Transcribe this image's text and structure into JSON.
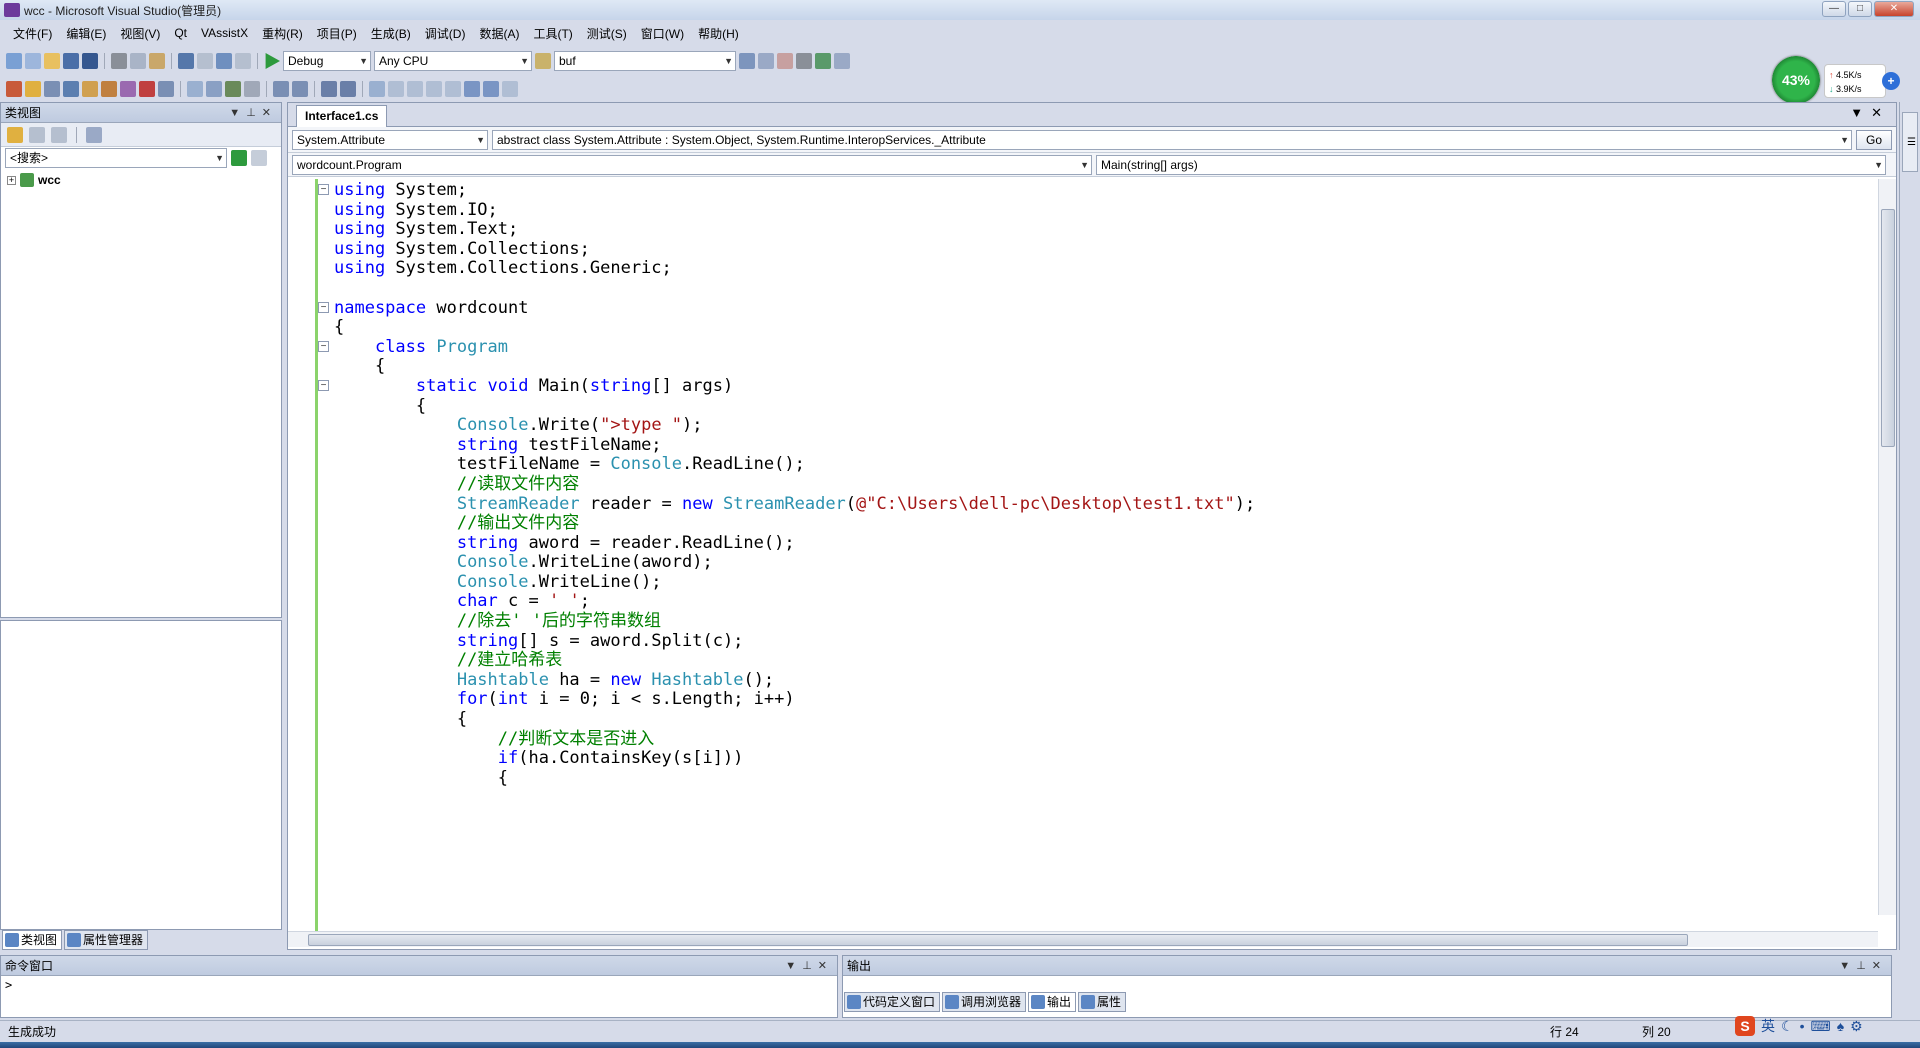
{
  "window": {
    "title": "wcc - Microsoft Visual Studio(管理员)"
  },
  "menu": [
    "文件(F)",
    "编辑(E)",
    "视图(V)",
    "Qt",
    "VAssistX",
    "重构(R)",
    "项目(P)",
    "生成(B)",
    "调试(D)",
    "数据(A)",
    "工具(T)",
    "测试(S)",
    "窗口(W)",
    "帮助(H)"
  ],
  "toolbar": {
    "config": "Debug",
    "platform": "Any CPU",
    "find": "buf"
  },
  "netwidget": {
    "percent": "43%",
    "up": "4.5K/s",
    "down": "3.9K/s",
    "plus": "+"
  },
  "classview": {
    "title": "类视图",
    "search_placeholder": "<搜索>",
    "tree_root": "wcc"
  },
  "left_tabs": [
    "类视图",
    "属性管理器"
  ],
  "editor": {
    "tab": "Interface1.cs",
    "nav_type": "System.Attribute",
    "nav_desc": "abstract class System.Attribute : System.Object, System.Runtime.InteropServices._Attribute",
    "go": "Go",
    "nav_class": "wordcount.Program",
    "nav_member": "Main(string[] args)"
  },
  "code_lines": [
    [
      [
        "kw",
        "using"
      ],
      [
        "",
        "System;"
      ]
    ],
    [
      [
        "kw",
        "using"
      ],
      [
        "",
        "System.IO;"
      ]
    ],
    [
      [
        "kw",
        "using"
      ],
      [
        "",
        "System.Text;"
      ]
    ],
    [
      [
        "kw",
        "using"
      ],
      [
        "",
        "System.Collections;"
      ]
    ],
    [
      [
        "kw",
        "using"
      ],
      [
        "",
        "System.Collections.Generic;"
      ]
    ],
    [],
    [
      [
        "kw",
        "namespace"
      ],
      [
        "",
        "wordcount"
      ]
    ],
    [
      [
        "",
        "{"
      ]
    ],
    [
      [
        "",
        "    "
      ],
      [
        "kw",
        "class"
      ],
      [
        "ty",
        "Program"
      ]
    ],
    [
      [
        "",
        "    {"
      ]
    ],
    [
      [
        "",
        "        "
      ],
      [
        "kw",
        "static"
      ],
      [
        "kw",
        "void"
      ],
      [
        "",
        "Main("
      ],
      [
        "kw",
        "string"
      ],
      [
        "",
        "[] args)"
      ]
    ],
    [
      [
        "",
        "        {"
      ]
    ],
    [
      [
        "",
        "            "
      ],
      [
        "ty",
        "Console"
      ],
      [
        "",
        ".Write("
      ],
      [
        "st",
        "\">type \""
      ],
      [
        "",
        ");"
      ]
    ],
    [
      [
        "",
        "            "
      ],
      [
        "kw",
        "string"
      ],
      [
        "",
        "testFileName;"
      ]
    ],
    [
      [
        "",
        "            testFileName = "
      ],
      [
        "ty",
        "Console"
      ],
      [
        "",
        ".ReadLine();"
      ]
    ],
    [
      [
        "",
        "            "
      ],
      [
        "cm",
        "//读取文件内容"
      ]
    ],
    [
      [
        "",
        "            "
      ],
      [
        "ty",
        "StreamReader"
      ],
      [
        "",
        "reader = "
      ],
      [
        "kw",
        "new"
      ],
      [
        "ty",
        "StreamReader"
      ],
      [
        "",
        "("
      ],
      [
        "st",
        "@\"C:\\Users\\dell-pc\\Desktop\\test1.txt\""
      ],
      [
        "",
        ");"
      ]
    ],
    [
      [
        "",
        "            "
      ],
      [
        "cm",
        "//输出文件内容"
      ]
    ],
    [
      [
        "",
        "            "
      ],
      [
        "kw",
        "string"
      ],
      [
        "",
        "aword = reader.ReadLine();"
      ]
    ],
    [
      [
        "",
        "            "
      ],
      [
        "ty",
        "Console"
      ],
      [
        "",
        ".WriteLine(aword);"
      ]
    ],
    [
      [
        "",
        "            "
      ],
      [
        "ty",
        "Console"
      ],
      [
        "",
        ".WriteLine();"
      ]
    ],
    [
      [
        "",
        "            "
      ],
      [
        "kw",
        "char"
      ],
      [
        "",
        "c = "
      ],
      [
        "st",
        "' '"
      ],
      [
        "",
        ";"
      ]
    ],
    [
      [
        "",
        "            "
      ],
      [
        "cm",
        "//除去' '后的字符串数组"
      ]
    ],
    [
      [
        "",
        "            "
      ],
      [
        "kw",
        "string"
      ],
      [
        "",
        "[] s = aword.Split(c);"
      ]
    ],
    [
      [
        "",
        "            "
      ],
      [
        "cm",
        "//建立哈希表"
      ]
    ],
    [
      [
        "",
        "            "
      ],
      [
        "ty",
        "Hashtable"
      ],
      [
        "",
        "ha = "
      ],
      [
        "kw",
        "new"
      ],
      [
        "ty",
        "Hashtable"
      ],
      [
        "",
        "();"
      ]
    ],
    [
      [
        "",
        "            "
      ],
      [
        "kw",
        "for"
      ],
      [
        "",
        "("
      ],
      [
        "kw",
        "int"
      ],
      [
        "",
        "i = 0; i < s.Length; i++)"
      ]
    ],
    [
      [
        "",
        "            {"
      ]
    ],
    [
      [
        "",
        "                "
      ],
      [
        "cm",
        "//判断文本是否进入"
      ]
    ],
    [
      [
        "",
        "                "
      ],
      [
        "kw",
        "if"
      ],
      [
        "",
        "(ha.ContainsKey(s[i]))"
      ]
    ],
    [
      [
        "",
        "                {"
      ]
    ]
  ],
  "bottom": {
    "cmd_title": "命令窗口",
    "cmd_prompt": ">",
    "out_title": "输出",
    "out_tabs": [
      "代码定义窗口",
      "调用浏览器",
      "输出",
      "属性"
    ]
  },
  "status": {
    "text": "生成成功",
    "row": "行 24",
    "col": "列 20"
  },
  "tray": {
    "ime": "英"
  }
}
